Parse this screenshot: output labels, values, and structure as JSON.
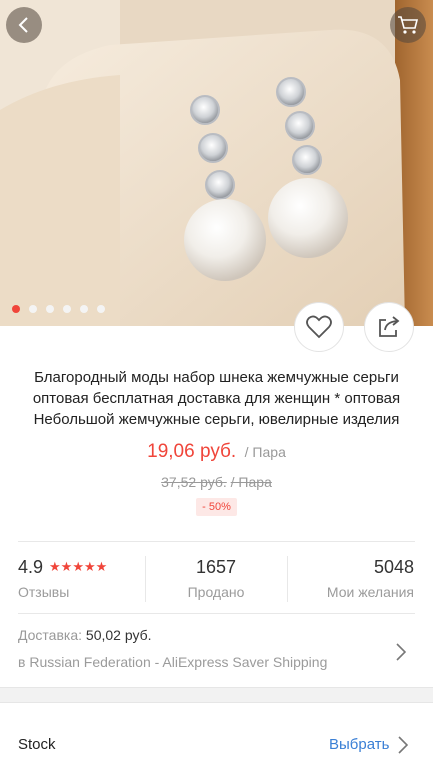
{
  "gallery": {
    "image_alt": "pearl earrings on display stand",
    "dot_count": 6,
    "active_dot": 0
  },
  "product": {
    "title": "Благородный моды набор шнека жемчужные серьги оптовая бесплатная доставка для женщин * оптовая Небольшой жемчужные серьги, ювелирные изделия",
    "price": "19,06 руб.",
    "price_unit": "/ Пара",
    "old_price": "37,52 руб.",
    "old_unit": "/ Пара",
    "discount": "- 50%"
  },
  "stats": {
    "rating": "4.9",
    "stars": "★★★★★",
    "reviews_label": "Отзывы",
    "sold": "1657",
    "sold_label": "Продано",
    "wishes": "5048",
    "wishes_label": "Мои желания"
  },
  "delivery": {
    "label": "Доставка:",
    "price": "50,02 руб.",
    "method": "в Russian Federation - AliExpress Saver Shipping"
  },
  "stock": {
    "label": "Stock",
    "choose": "Выбрать"
  },
  "colors": {
    "accent": "#f0453a",
    "link": "#3a7fd5"
  },
  "icons": [
    "chevron-left-icon",
    "cart-icon",
    "heart-icon",
    "share-icon",
    "chevron-right-icon"
  ]
}
